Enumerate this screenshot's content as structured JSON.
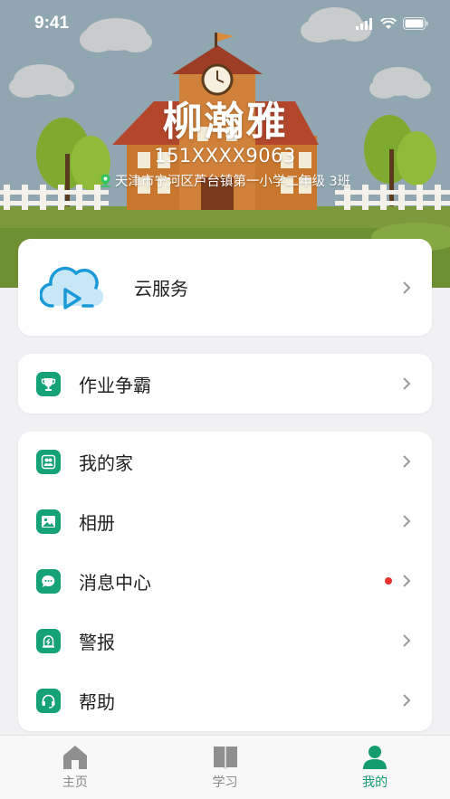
{
  "status_bar": {
    "time": "9:41"
  },
  "profile": {
    "name": "柳瀚雅",
    "phone": "151XXXX9063",
    "school": "天津市宁河区芦台镇第一小学二年级 3班"
  },
  "cloud_service": {
    "label": "云服务"
  },
  "homework": {
    "label": "作业争霸"
  },
  "menu": [
    {
      "label": "我的家",
      "icon": "family-icon",
      "badge": false
    },
    {
      "label": "相册",
      "icon": "album-icon",
      "badge": false
    },
    {
      "label": "消息中心",
      "icon": "message-icon",
      "badge": true
    },
    {
      "label": "警报",
      "icon": "alarm-icon",
      "badge": false
    },
    {
      "label": "帮助",
      "icon": "headset-icon",
      "badge": false
    }
  ],
  "tabbar": {
    "tabs": [
      {
        "label": "主页",
        "icon": "home-icon",
        "active": false
      },
      {
        "label": "学习",
        "icon": "book-icon",
        "active": false
      },
      {
        "label": "我的",
        "icon": "person-icon",
        "active": true
      }
    ]
  },
  "colors": {
    "accent": "#139c6e",
    "sky": "#90a7b1",
    "grass": "#7a9a3a",
    "badge": "#e8322e"
  }
}
